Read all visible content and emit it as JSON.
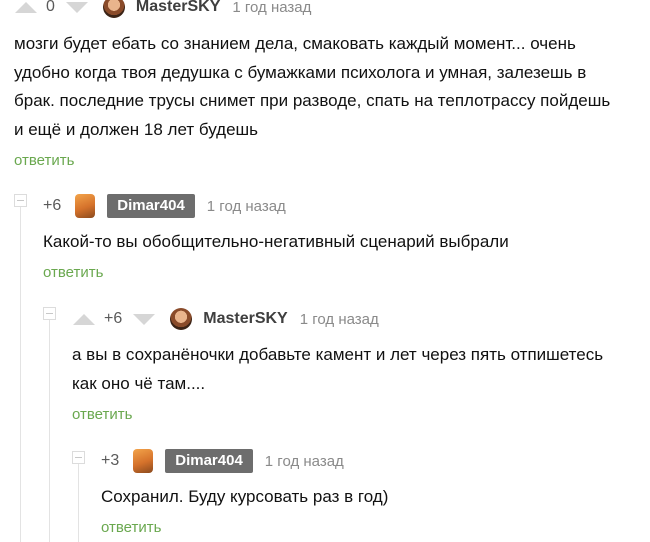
{
  "comments": [
    {
      "rating": "0",
      "username": "MasterSKY",
      "time": "1 год назад",
      "text": "мозги будет ебать со знанием дела, смаковать каждый момент... очень удобно когда твоя дедушка с бумажками психолога и умная, залезешь в брак. последние трусы снимет при разводе, спать на теплотрассу пойдешь и ещё и должен 18 лет будешь",
      "reply": "ответить"
    },
    {
      "rating": "+6",
      "username": "Dimar404",
      "time": "1 год назад",
      "text": "Какой-то вы обобщительно-негативный сценарий выбрали",
      "reply": "ответить"
    },
    {
      "rating": "+6",
      "username": "MasterSKY",
      "time": "1 год назад",
      "text": "а вы в сохранёночки добавьте камент и лет через пять отпишетесь как оно чё там....",
      "reply": "ответить"
    },
    {
      "rating": "+3",
      "username": "Dimar404",
      "time": "1 год назад",
      "text": "Сохранил. Буду курсовать раз в год)",
      "reply": "ответить"
    }
  ]
}
